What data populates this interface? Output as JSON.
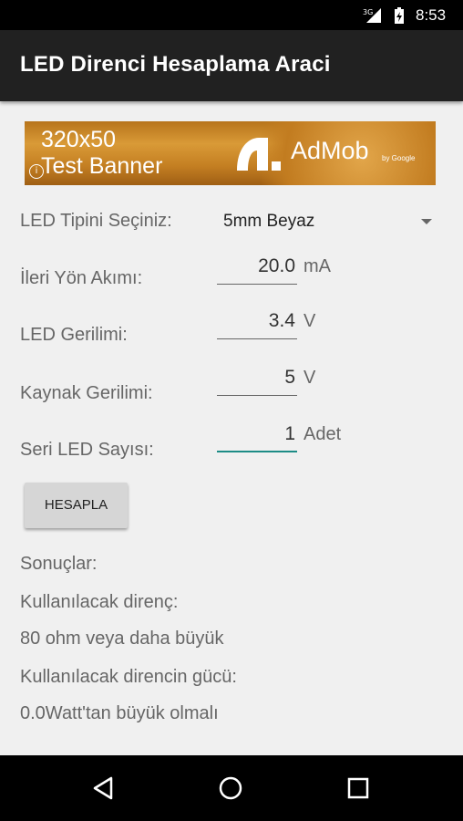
{
  "status_bar": {
    "network": "3G",
    "time": "8:53"
  },
  "app_bar": {
    "title": "LED Direnci Hesaplama Araci"
  },
  "ad": {
    "size_text": "320x50",
    "label": "Test Banner",
    "brand": "AdMob",
    "by": "by Google"
  },
  "form": {
    "led_type": {
      "label": "LED Tipini Seçiniz:",
      "value": "5mm Beyaz"
    },
    "forward_current": {
      "label": "İleri Yön Akımı:",
      "value": "20.0",
      "unit": "mA"
    },
    "led_voltage": {
      "label": "LED Gerilimi:",
      "value": "3.4",
      "unit": "V"
    },
    "source_voltage": {
      "label": "Kaynak Gerilimi:",
      "value": "5",
      "unit": "V"
    },
    "series_count": {
      "label": "Seri LED Sayısı:",
      "value": "1",
      "unit": "Adet"
    },
    "calculate_label": "HESAPLA"
  },
  "results": {
    "heading": "Sonuçlar:",
    "resistor_label": "Kullanılacak direnç:",
    "resistor_value": "80 ohm veya daha büyük",
    "power_label": "Kullanılacak direncin gücü:",
    "power_value": "0.0Watt'tan büyük olmalı"
  },
  "colors": {
    "accent": "#1d8c86",
    "app_bar": "#212121",
    "background": "#f0f0f0"
  },
  "icons": [
    "signal-icon",
    "battery-icon",
    "info-icon",
    "admob-logo-icon",
    "dropdown-arrow-icon",
    "back-icon",
    "home-icon",
    "recents-icon"
  ]
}
